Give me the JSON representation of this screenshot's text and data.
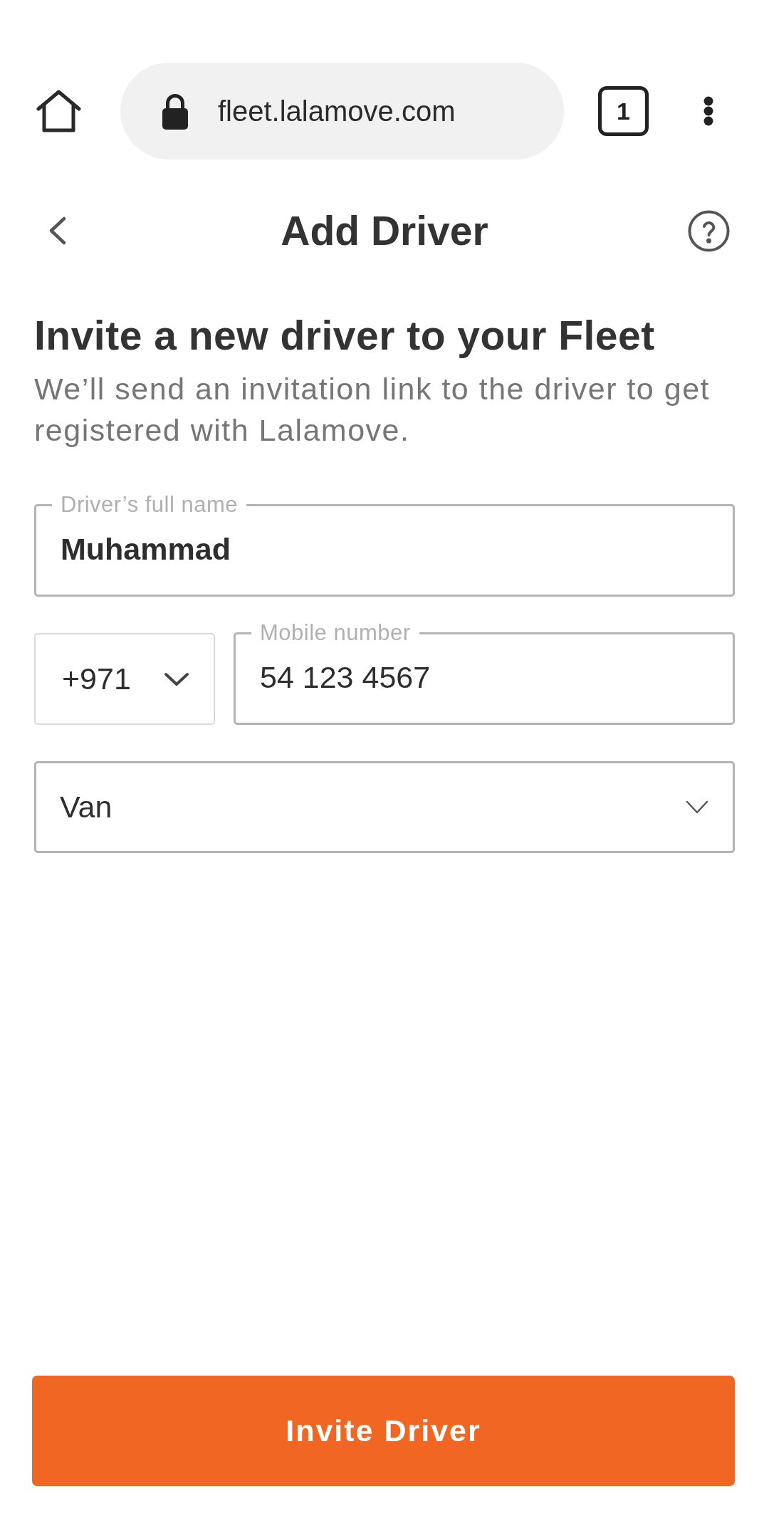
{
  "browser_bar": {
    "url": "fleet.lalamove.com",
    "tab_count": "1"
  },
  "header": {
    "title": "Add Driver"
  },
  "intro": {
    "heading": "Invite a new driver to your Fleet",
    "description": "We’ll send an invitation link to the driver to get registered with Lalamove."
  },
  "form": {
    "full_name": {
      "label": "Driver’s full name",
      "value": "Muhammad"
    },
    "country_code": {
      "value": "+971"
    },
    "mobile_number": {
      "label": "Mobile number",
      "value": "54 123 4567"
    },
    "vehicle_type": {
      "value": "Van"
    }
  },
  "submit_button": {
    "label": "Invite Driver"
  }
}
